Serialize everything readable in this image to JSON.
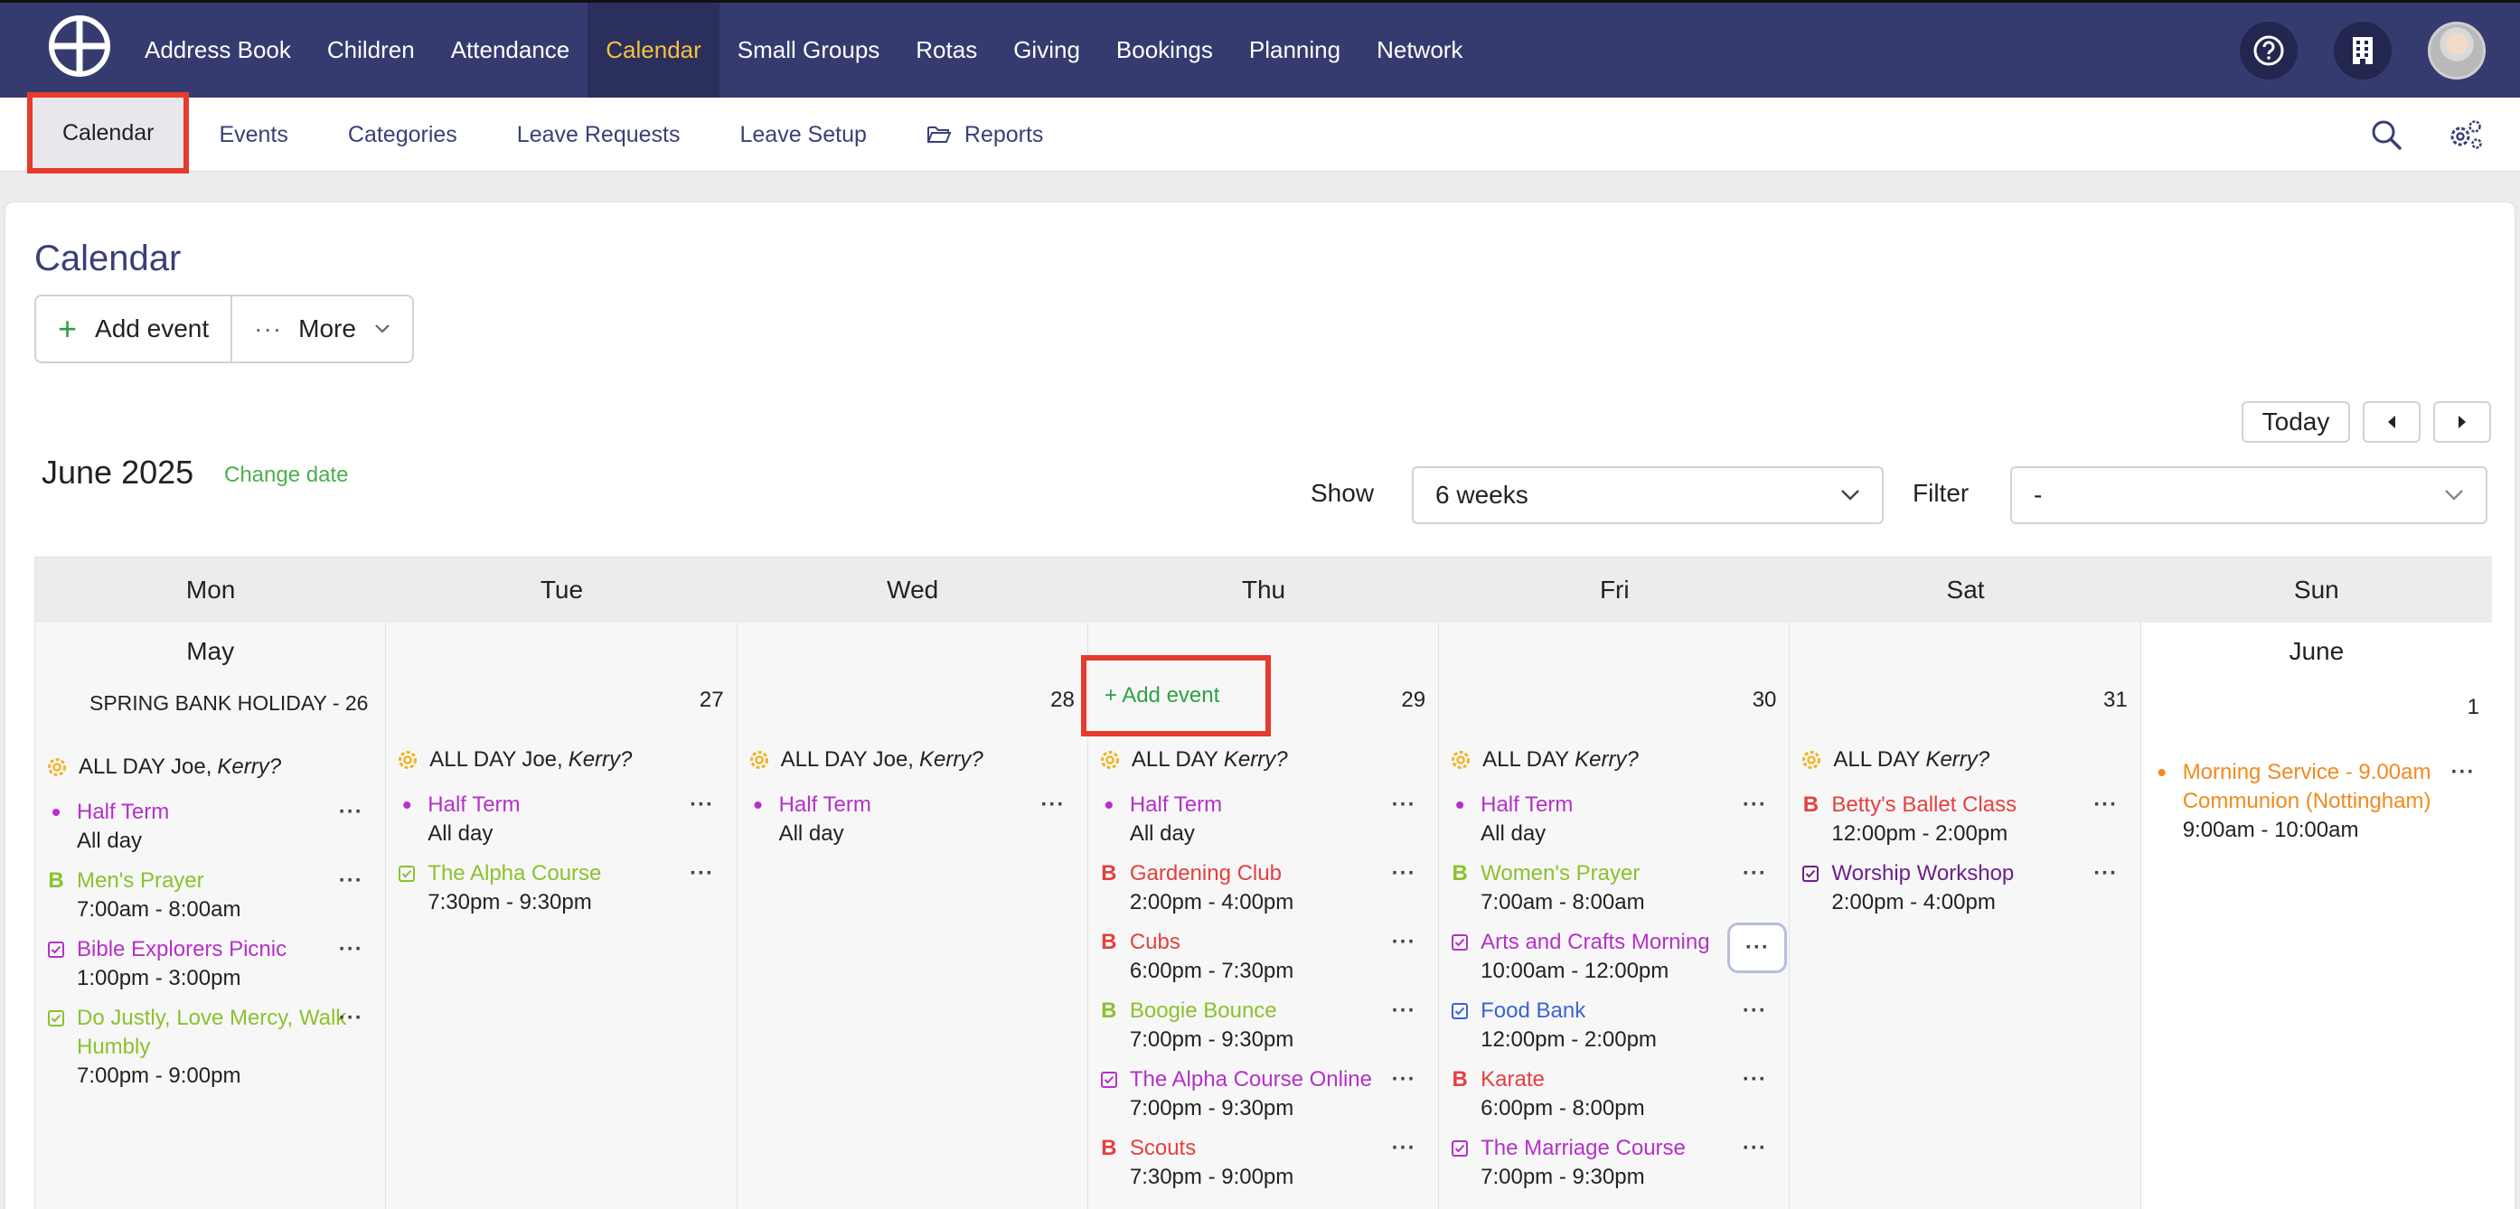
{
  "colors": {
    "nav_bg": "#363b6f",
    "nav_active": "#f5c242",
    "highlight_border": "#e53b2c",
    "accent_green": "#2ea043",
    "purple": "#b531c7",
    "green": "#8ac22c",
    "red": "#e5403e",
    "blue": "#3a63d6",
    "dark_purple": "#6b2287",
    "orange": "#f28a1e"
  },
  "topnav": {
    "items": [
      "Address Book",
      "Children",
      "Attendance",
      "Calendar",
      "Small Groups",
      "Rotas",
      "Giving",
      "Bookings",
      "Planning",
      "Network"
    ],
    "active_index": 3,
    "icons": [
      "help-icon",
      "building-icon",
      "avatar"
    ]
  },
  "subnav": {
    "items": [
      "Calendar",
      "Events",
      "Categories",
      "Leave Requests",
      "Leave Setup",
      "Reports"
    ],
    "active_index": 0,
    "icons": [
      "search-icon",
      "settings-icon"
    ]
  },
  "page": {
    "title": "Calendar",
    "add_event": "Add event",
    "more": "More",
    "month": "June 2025",
    "change_date": "Change date",
    "today": "Today",
    "show_label": "Show",
    "show_value": "6 weeks",
    "filter_label": "Filter",
    "filter_value": "-"
  },
  "calendar": {
    "weekdays": [
      "Mon",
      "Tue",
      "Wed",
      "Thu",
      "Fri",
      "Sat",
      "Sun"
    ],
    "days": [
      {
        "month_name": "May",
        "holiday": "SPRING BANK HOLIDAY - 26",
        "allday_names": "Joe,",
        "allday_italic": "Kerry?",
        "allday_prefix": "ALL DAY",
        "events": [
          {
            "title": "Half Term",
            "time": "All day",
            "kind": "dot",
            "color": "#b531c7"
          },
          {
            "title": "Men's Prayer",
            "time": "7:00am - 8:00am",
            "kind": "B",
            "color": "#8ac22c"
          },
          {
            "title": "Bible Explorers Picnic",
            "time": "1:00pm - 3:00pm",
            "kind": "check",
            "color": "#b531c7"
          },
          {
            "title": "Do Justly, Love Mercy, Walk Humbly",
            "time": "7:00pm - 9:00pm",
            "kind": "check",
            "color": "#8ac22c"
          }
        ]
      },
      {
        "day": "27",
        "allday_prefix": "ALL DAY",
        "allday_names": "Joe,",
        "allday_italic": "Kerry?",
        "events": [
          {
            "title": "Half Term",
            "time": "All day",
            "kind": "dot",
            "color": "#b531c7"
          },
          {
            "title": "The Alpha Course",
            "time": "7:30pm - 9:30pm",
            "kind": "check",
            "color": "#8ac22c"
          }
        ]
      },
      {
        "day": "28",
        "allday_prefix": "ALL DAY",
        "allday_names": "Joe,",
        "allday_italic": "Kerry?",
        "events": [
          {
            "title": "Half Term",
            "time": "All day",
            "kind": "dot",
            "color": "#b531c7"
          }
        ]
      },
      {
        "day": "29",
        "add_event": "+ Add event",
        "allday_prefix": "ALL DAY",
        "allday_names": "",
        "allday_italic": "Kerry?",
        "events": [
          {
            "title": "Half Term",
            "time": "All day",
            "kind": "dot",
            "color": "#b531c7"
          },
          {
            "title": "Gardening Club",
            "time": "2:00pm - 4:00pm",
            "kind": "B",
            "color": "#e5403e"
          },
          {
            "title": "Cubs",
            "time": "6:00pm - 7:30pm",
            "kind": "B",
            "color": "#e5403e"
          },
          {
            "title": "Boogie Bounce",
            "time": "7:00pm - 9:30pm",
            "kind": "B",
            "color": "#8ac22c"
          },
          {
            "title": "The Alpha Course Online",
            "time": "7:00pm - 9:30pm",
            "kind": "check",
            "color": "#b531c7"
          },
          {
            "title": "Scouts",
            "time": "7:30pm - 9:00pm",
            "kind": "B",
            "color": "#e5403e"
          }
        ]
      },
      {
        "day": "30",
        "allday_prefix": "ALL DAY",
        "allday_names": "",
        "allday_italic": "Kerry?",
        "events": [
          {
            "title": "Half Term",
            "time": "All day",
            "kind": "dot",
            "color": "#b531c7"
          },
          {
            "title": "Women's Prayer",
            "time": "7:00am - 8:00am",
            "kind": "B",
            "color": "#8ac22c"
          },
          {
            "title": "Arts and Crafts Morning",
            "time": "10:00am - 12:00pm",
            "kind": "check",
            "color": "#b531c7",
            "focused": true
          },
          {
            "title": "Food Bank",
            "time": "12:00pm - 2:00pm",
            "kind": "check",
            "color": "#3a63d6"
          },
          {
            "title": "Karate",
            "time": "6:00pm - 8:00pm",
            "kind": "B",
            "color": "#e5403e"
          },
          {
            "title": "The Marriage Course",
            "time": "7:00pm - 9:30pm",
            "kind": "check",
            "color": "#b531c7"
          }
        ]
      },
      {
        "day": "31",
        "allday_prefix": "ALL DAY",
        "allday_names": "",
        "allday_italic": "Kerry?",
        "events": [
          {
            "title": "Betty's Ballet Class",
            "time": "12:00pm - 2:00pm",
            "kind": "B",
            "color": "#e5403e"
          },
          {
            "title": "Worship Workshop",
            "time": "2:00pm - 4:00pm",
            "kind": "check",
            "color": "#6b2287"
          }
        ]
      },
      {
        "month_name": "June",
        "day": "1",
        "events": [
          {
            "title": "Morning Service - 9.00am Communion (Nottingham)",
            "time": "9:00am - 10:00am",
            "kind": "dot",
            "color": "#f28a1e"
          }
        ]
      }
    ]
  }
}
